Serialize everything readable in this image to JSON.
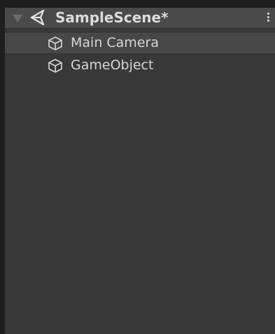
{
  "hierarchy": {
    "scene": {
      "title": "SampleScene*",
      "expanded": true,
      "icon": "unity-scene-icon"
    },
    "menu_icon": "kebab-menu-icon",
    "items": [
      {
        "label": "Main Camera",
        "icon": "cube-icon",
        "selected": true
      },
      {
        "label": "GameObject",
        "icon": "cube-icon",
        "selected": false
      }
    ]
  },
  "colors": {
    "panel_background": "#383838",
    "header_background": "#4a4a4a",
    "text": "#d2d2d2"
  }
}
